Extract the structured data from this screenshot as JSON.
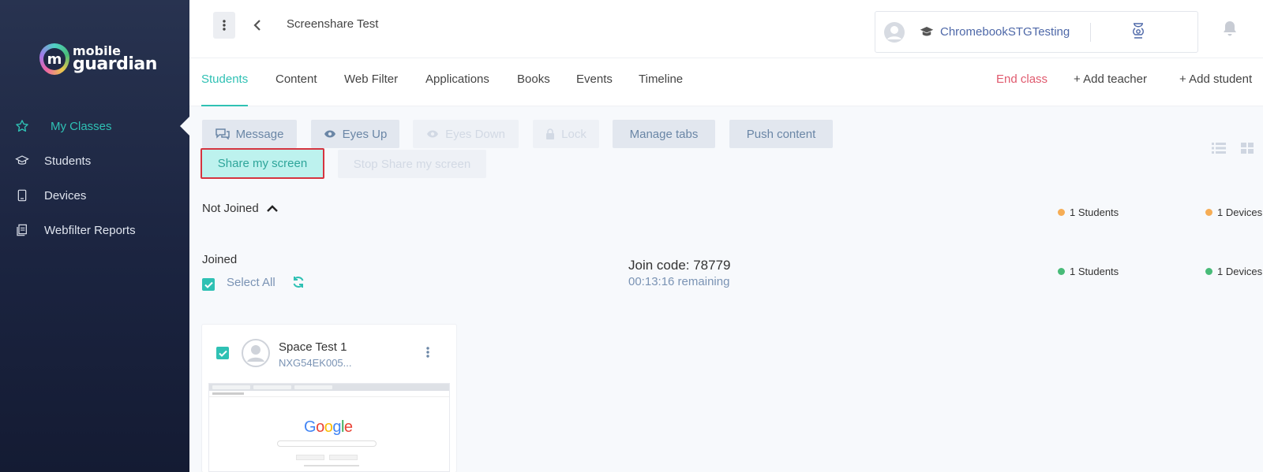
{
  "brand": {
    "logo_letter": "m",
    "line1": "mobile",
    "line2": "guardian"
  },
  "sidebar": {
    "items": [
      {
        "label": "My Classes",
        "icon": "star-icon",
        "active": true
      },
      {
        "label": "Students",
        "icon": "graduation-cap-icon"
      },
      {
        "label": "Devices",
        "icon": "device-icon"
      },
      {
        "label": "Webfilter Reports",
        "icon": "report-icon"
      }
    ]
  },
  "header": {
    "class_title": "Screenshare Test",
    "user_name": "ChromebookSTGTesting"
  },
  "tabs": [
    {
      "label": "Students",
      "active": true
    },
    {
      "label": "Content"
    },
    {
      "label": "Web Filter"
    },
    {
      "label": "Applications"
    },
    {
      "label": "Books"
    },
    {
      "label": "Events"
    },
    {
      "label": "Timeline"
    }
  ],
  "tab_actions": {
    "end_class": "End class",
    "add_teacher": "+ Add teacher",
    "add_student": "+ Add student"
  },
  "actions": {
    "message": "Message",
    "eyes_up": "Eyes Up",
    "eyes_down": "Eyes Down",
    "lock": "Lock",
    "manage_tabs": "Manage tabs",
    "push_content": "Push content",
    "share_screen": "Share my screen",
    "stop_share": "Stop Share my screen"
  },
  "not_joined": {
    "label": "Not Joined",
    "students": "1 Students",
    "devices": "1 Devices"
  },
  "joined": {
    "label": "Joined",
    "select_all": "Select All",
    "join_code": "Join code: 78779",
    "remaining": "00:13:16 remaining",
    "students": "1 Students",
    "devices": "1 Devices"
  },
  "student_card": {
    "name": "Space Test 1",
    "device": "NXG54EK005..."
  },
  "colors": {
    "accent": "#2fc1b4",
    "sidebar_bg": "#1b2440",
    "danger": "#e05a6e",
    "not_joined_dot": "#f6ad55",
    "joined_dot": "#48bb78",
    "highlight_border": "#d5343f"
  }
}
